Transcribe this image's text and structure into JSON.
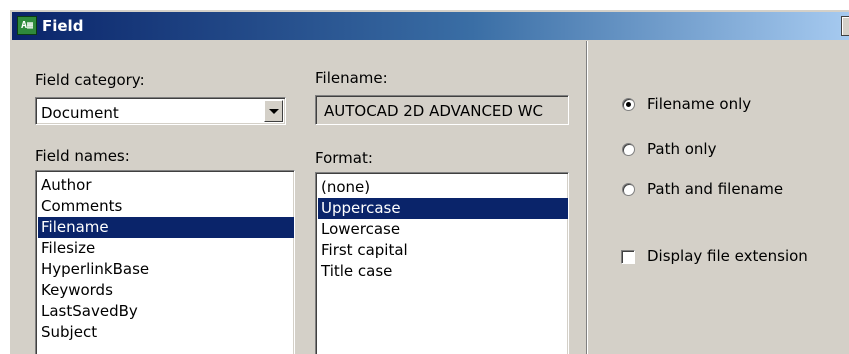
{
  "window": {
    "title": "Field",
    "icon": "field-app-icon",
    "close_glyph": "x"
  },
  "left": {
    "category_label": "Field category:",
    "category_value": "Document",
    "names_label": "Field names:",
    "names": [
      "Author",
      "Comments",
      "Filename",
      "Filesize",
      "HyperlinkBase",
      "Keywords",
      "LastSavedBy",
      "Subject"
    ],
    "names_selected": "Filename"
  },
  "middle": {
    "filename_label": "Filename:",
    "filename_value": "AUTOCAD 2D ADVANCED WC",
    "format_label": "Format:",
    "formats": [
      "(none)",
      "Uppercase",
      "Lowercase",
      "First capital",
      "Title case"
    ],
    "format_selected": "Uppercase"
  },
  "right": {
    "radio_filename_only": "Filename only",
    "radio_path_only": "Path only",
    "radio_path_and_filename": "Path and filename",
    "radio_selected": "Filename only",
    "checkbox_display_ext": "Display file extension",
    "checkbox_display_ext_checked": false
  },
  "colors": {
    "titlebar_start": "#0a246a",
    "titlebar_end": "#a6caf0",
    "selection": "#0a246a",
    "dialog_bg": "#d4d0c8"
  }
}
